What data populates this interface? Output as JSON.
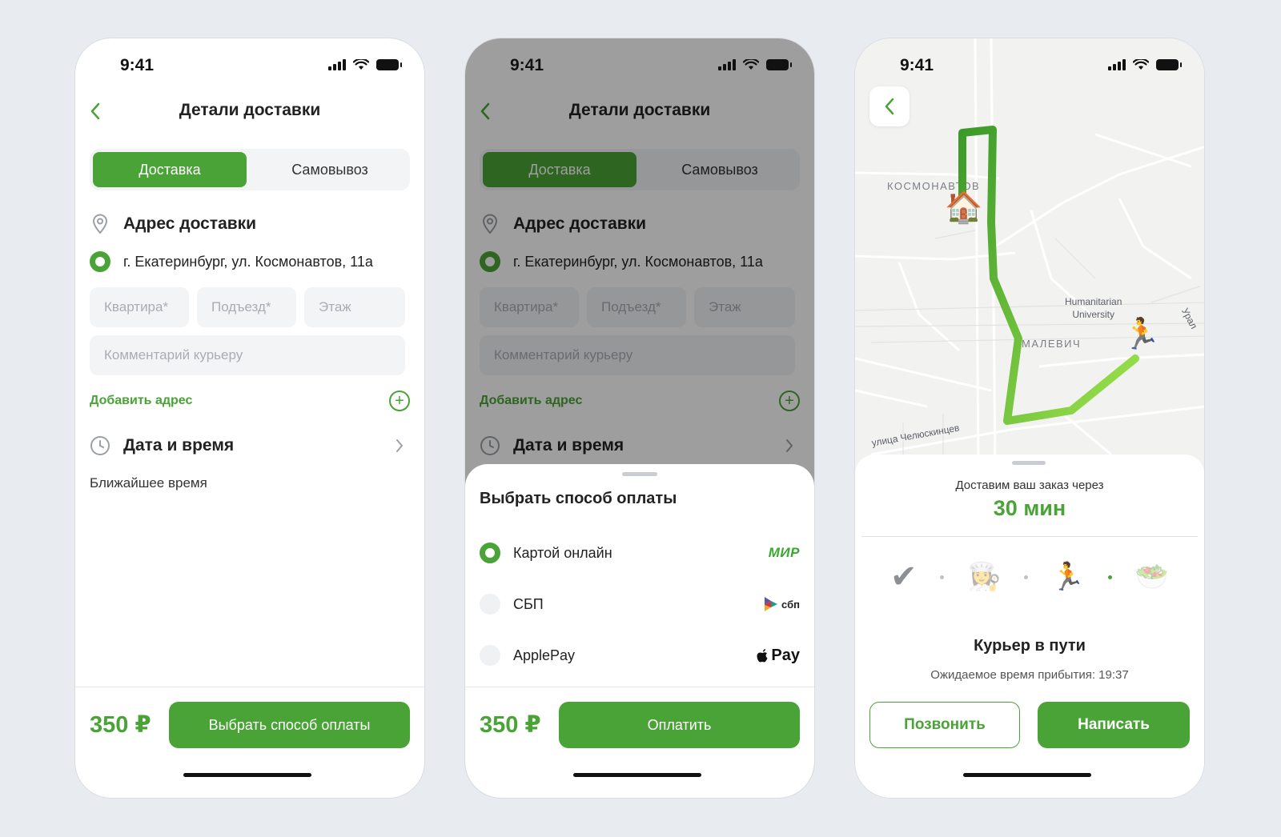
{
  "status": {
    "time": "9:41"
  },
  "colors": {
    "accent": "#4aa336",
    "background": "#e8ebf0"
  },
  "delivery": {
    "title": "Детали доставки",
    "tabs": [
      {
        "label": "Доставка",
        "active": true
      },
      {
        "label": "Самовывоз",
        "active": false
      }
    ],
    "address_section": "Адрес доставки",
    "address": "г. Екатеринбург, ул. Космонавтов, 11а",
    "fields": {
      "apartment": "Квартира*",
      "entrance": "Подъезд*",
      "floor": "Этаж",
      "comment": "Комментарий курьеру"
    },
    "add_address": "Добавить адрес",
    "datetime_section": "Дата и время",
    "nearest_time": "Ближайшее время",
    "price": "350 ₽",
    "choose_payment_button": "Выбрать способ оплаты"
  },
  "payment_sheet": {
    "title": "Выбрать способ оплаты",
    "options": [
      {
        "label": "Картой онлайн",
        "logo": "МИР",
        "logo_icon": "mir-logo",
        "selected": true
      },
      {
        "label": "СБП",
        "logo": "сбп",
        "logo_icon": "sbp-logo",
        "selected": false
      },
      {
        "label": "ApplePay",
        "logo": "Pay",
        "logo_icon": "apple-pay-logo",
        "selected": false
      }
    ],
    "price": "350 ₽",
    "pay_button": "Оплатить"
  },
  "tracking": {
    "map_labels": {
      "kosmonavtov": "КОСМОНАВТОВ",
      "malevich": "МАЛЕВИЧ",
      "university_line1": "Humanitarian",
      "university_line2": "University",
      "street": "улица Челюскинцев",
      "ural": "Урал"
    },
    "eta_caption": "Доставим ваш заказ через",
    "eta_value": "30 мин",
    "steps": [
      {
        "icon": "✔",
        "name": "confirmed-check-icon"
      },
      {
        "icon": "👩‍🍳",
        "name": "cook-icon"
      },
      {
        "icon": "🏃",
        "name": "courier-icon"
      },
      {
        "icon": "🥗",
        "name": "salad-icon"
      }
    ],
    "status": "Курьер в пути",
    "arrival": "Ожидаемое время прибытия: 19:37",
    "call_button": "Позвонить",
    "message_button": "Написать"
  }
}
